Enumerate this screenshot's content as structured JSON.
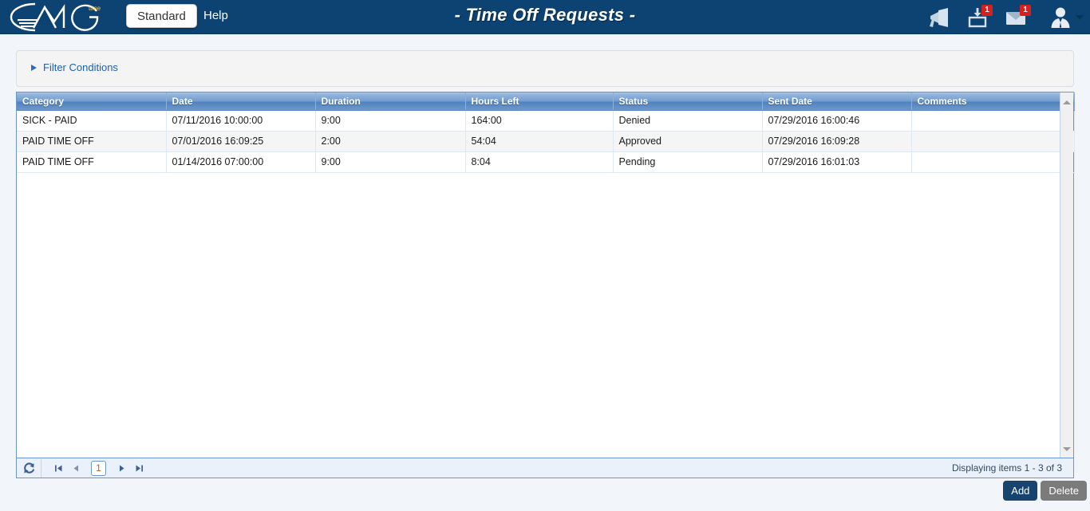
{
  "header": {
    "logo_alt": "AMG time",
    "logo_sub": "time",
    "standard_label": "Standard",
    "help_label": "Help",
    "title": "- Time Off Requests -",
    "icons": [
      {
        "name": "announcement-icon",
        "badge": ""
      },
      {
        "name": "inbox-icon",
        "badge": "1"
      },
      {
        "name": "mail-icon",
        "badge": "1"
      },
      {
        "name": "user-avatar-icon",
        "badge": ""
      }
    ],
    "brand_color": "#0c4372",
    "badge_color": "#d61f1f"
  },
  "filter": {
    "label": "Filter Conditions",
    "expanded": false
  },
  "grid": {
    "columns": [
      "Category",
      "Date",
      "Duration",
      "Hours Left",
      "Status",
      "Sent Date",
      "Comments"
    ],
    "rows": [
      {
        "category": "SICK - PAID",
        "date": "07/11/2016 10:00:00",
        "duration": "9:00",
        "hours_left": "164:00",
        "status": "Denied",
        "sent_date": "07/29/2016 16:00:46",
        "comments": ""
      },
      {
        "category": "PAID TIME OFF",
        "date": "07/01/2016 16:09:25",
        "duration": "2:00",
        "hours_left": "54:04",
        "status": "Approved",
        "sent_date": "07/29/2016 16:09:28",
        "comments": ""
      },
      {
        "category": "PAID TIME OFF",
        "date": "01/14/2016 07:00:00",
        "duration": "9:00",
        "hours_left": "8:04",
        "status": "Pending",
        "sent_date": "07/29/2016 16:01:03",
        "comments": ""
      }
    ]
  },
  "pager": {
    "refresh_icon": "refresh-icon",
    "first_icon": "first-page-icon",
    "prev_icon": "previous-page-icon",
    "current_page": "1",
    "next_icon": "next-page-icon",
    "last_icon": "last-page-icon",
    "info": "Displaying items 1 - 3 of 3"
  },
  "actions": {
    "add_label": "Add",
    "delete_label": "Delete",
    "add_color": "#16446e",
    "delete_color": "#7b7b7b"
  }
}
